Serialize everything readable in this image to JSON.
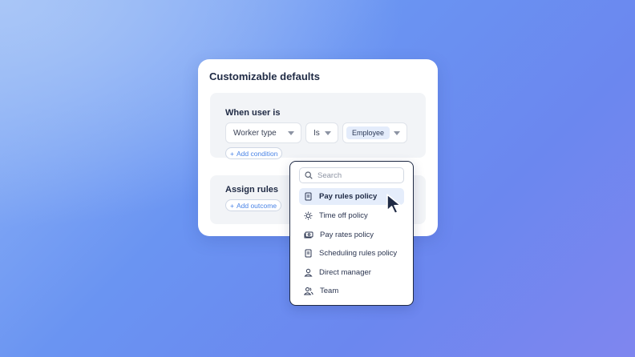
{
  "card": {
    "title": "Customizable defaults",
    "when": {
      "heading": "When user is",
      "field": "Worker type",
      "operator": "Is",
      "value": "Employee",
      "add_label": "Add condition"
    },
    "assign": {
      "heading": "Assign rules",
      "add_label": "Add outcome"
    }
  },
  "dropdown": {
    "search_placeholder": "Search",
    "items": [
      {
        "label": "Pay rules policy",
        "icon": "document-icon",
        "active": true
      },
      {
        "label": "Time off policy",
        "icon": "sun-icon",
        "active": false
      },
      {
        "label": "Pay rates policy",
        "icon": "cash-icon",
        "active": false
      },
      {
        "label": "Scheduling rules policy",
        "icon": "document-icon",
        "active": false
      },
      {
        "label": "Direct manager",
        "icon": "person-icon",
        "active": false
      },
      {
        "label": "Team",
        "icon": "team-icon",
        "active": false
      }
    ]
  },
  "colors": {
    "accent": "#4a84e6",
    "active_bg": "#e5edfb",
    "text_dark": "#1f2a44"
  }
}
